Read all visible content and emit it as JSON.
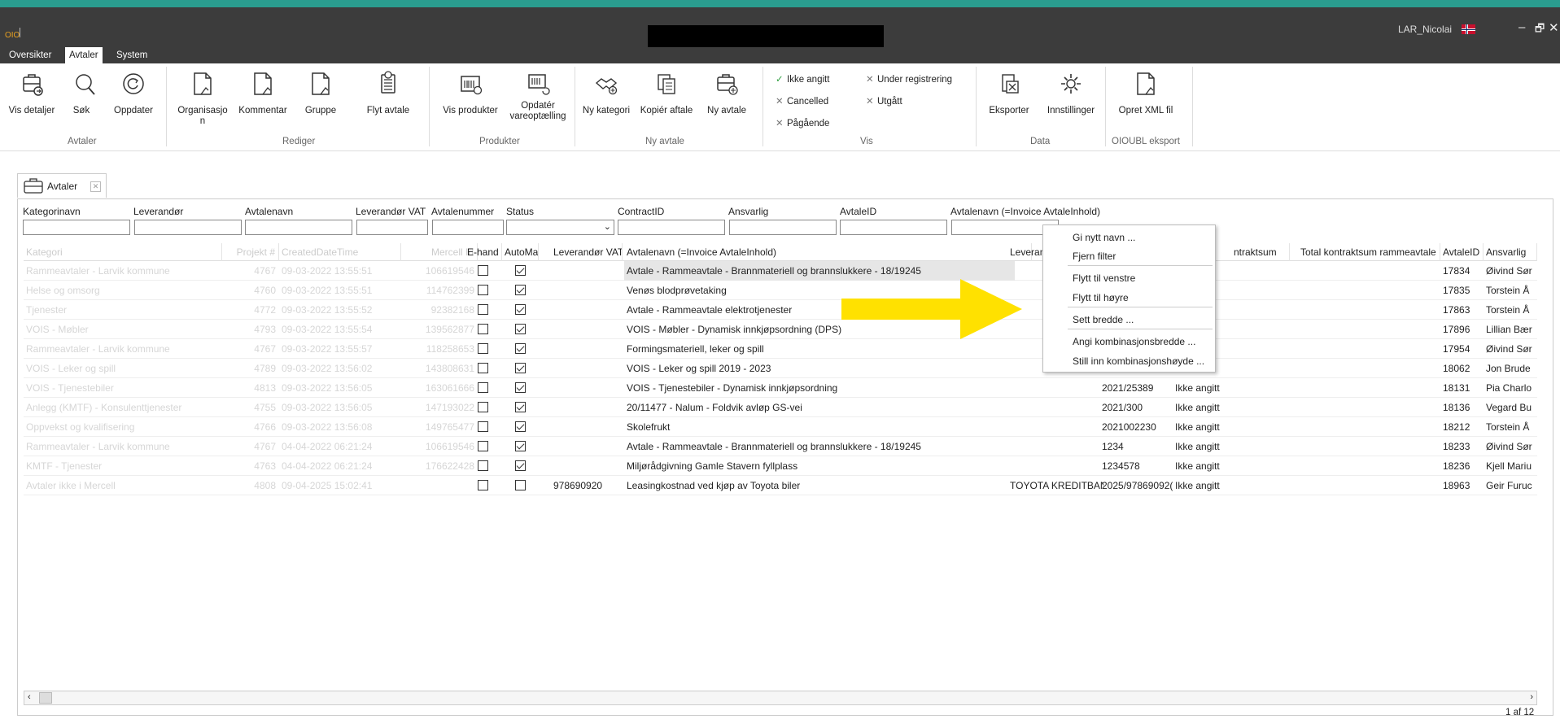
{
  "titlebar": {
    "app_logo": "OIO",
    "user": "LAR_Nicolai",
    "controls": {
      "minimize": "–",
      "restore": "🗗",
      "close": "✕"
    }
  },
  "menu_tabs": [
    "Oversikter",
    "Avtaler",
    "System"
  ],
  "ribbon": {
    "buttons": {
      "vis_detaljer": "Vis detaljer",
      "sok": "Søk",
      "oppdater": "Oppdater",
      "organisasjon_1": "Organisasjo",
      "organisasjon_2": "n",
      "kommentar": "Kommentar",
      "gruppe": "Gruppe",
      "flyt_avtale": "Flyt avtale",
      "vis_produkter": "Vis produkter",
      "opdater_1": "Opdatér",
      "opdater_2": "vareoptælling",
      "ny_kategori": "Ny kategori",
      "kopier_aftale": "Kopiér aftale",
      "ny_avtale": "Ny avtale",
      "eksporter": "Eksporter",
      "innstillinger": "Innstillinger",
      "opret_xml": "Opret XML fil"
    },
    "vis_filters": {
      "ikke_angitt": "Ikke angitt",
      "under_registrering": "Under registrering",
      "cancelled": "Cancelled",
      "utgatt": "Utgått",
      "pagaende": "Pågående"
    },
    "groups": {
      "avtaler": "Avtaler",
      "rediger": "Rediger",
      "produkter": "Produkter",
      "ny_avtale": "Ny avtale",
      "vis": "Vis",
      "data": "Data",
      "oioubl": "OIOUBL eksport"
    }
  },
  "doc_tab": {
    "label": "Avtaler"
  },
  "filters": {
    "kategorinavn": "Kategorinavn",
    "leverandor": "Leverandør",
    "avtalenavn": "Avtalenavn",
    "leverandor_vat": "Leverandør VAT",
    "avtalenummer": "Avtalenummer",
    "status": "Status",
    "contractid": "ContractID",
    "ansvarlig": "Ansvarlig",
    "avtaleid": "AvtaleID",
    "avtalenavn_invoice": "Avtalenavn (=Invoice AvtaleInhold)"
  },
  "grid": {
    "headers": {
      "kategori": "Kategori",
      "projekt": "Projekt #",
      "created": "CreatedDateTime",
      "mercell": "Mercell Id",
      "ehand": "E-hand",
      "automatch": "AutoMatcł",
      "levvat": "Leverandør VAT",
      "avtalenavn": "Avtalenavn (=Invoice AvtaleInhold)",
      "leveran": "Leveran",
      "kontraktsum": "ntraktsum",
      "total": "Total kontraktsum rammeavtale",
      "avtaleid": "AvtaleID",
      "ansvarlig": "Ansvarlig"
    },
    "rows": [
      {
        "kategori": "Rammeavtaler - Larvik kommune",
        "projekt": "4767",
        "created": "09-03-2022 13:55:51",
        "mercell": "106619546",
        "ehand": false,
        "auto": true,
        "levvat": "",
        "avtalenavn": "Avtale - Rammeavtale - Brannmateriell og brannslukkere - 18/19245",
        "leveran": "",
        "avtalenr": "",
        "status": "",
        "avtaleid": "17834",
        "ansvarlig": "Øivind Sør"
      },
      {
        "kategori": "Helse og omsorg",
        "projekt": "4760",
        "created": "09-03-2022 13:55:51",
        "mercell": "114762399",
        "ehand": false,
        "auto": true,
        "levvat": "",
        "avtalenavn": "Venøs blodprøvetaking",
        "leveran": "",
        "avtalenr": "",
        "status": "",
        "avtaleid": "17835",
        "ansvarlig": "Torstein Å"
      },
      {
        "kategori": "Tjenester",
        "projekt": "4772",
        "created": "09-03-2022 13:55:52",
        "mercell": "92382168",
        "ehand": false,
        "auto": true,
        "levvat": "",
        "avtalenavn": "Avtale - Rammeavtale elektrotjenester",
        "leveran": "",
        "avtalenr": "",
        "status": "",
        "avtaleid": "17863",
        "ansvarlig": "Torstein Å"
      },
      {
        "kategori": "VOIS - Møbler",
        "projekt": "4793",
        "created": "09-03-2022 13:55:54",
        "mercell": "139562877",
        "ehand": false,
        "auto": true,
        "levvat": "",
        "avtalenavn": "VOIS - Møbler - Dynamisk innkjøpsordning (DPS)",
        "leveran": "",
        "avtalenr": "",
        "status": "",
        "avtaleid": "17896",
        "ansvarlig": "Lillian Bær"
      },
      {
        "kategori": "Rammeavtaler - Larvik kommune",
        "projekt": "4767",
        "created": "09-03-2022 13:55:57",
        "mercell": "118258653",
        "ehand": false,
        "auto": true,
        "levvat": "",
        "avtalenavn": "Formingsmateriell, leker og spill",
        "leveran": "",
        "avtalenr": "",
        "status": "",
        "avtaleid": "17954",
        "ansvarlig": "Øivind Sør"
      },
      {
        "kategori": "VOIS - Leker og spill",
        "projekt": "4789",
        "created": "09-03-2022 13:56:02",
        "mercell": "143808631",
        "ehand": false,
        "auto": true,
        "levvat": "",
        "avtalenavn": "VOIS - Leker og spill 2019 - 2023",
        "leveran": "",
        "avtalenr": "",
        "status": "",
        "avtaleid": "18062",
        "ansvarlig": "Jon Brude"
      },
      {
        "kategori": "VOIS - Tjenestebiler",
        "projekt": "4813",
        "created": "09-03-2022 13:56:05",
        "mercell": "163061666",
        "ehand": false,
        "auto": true,
        "levvat": "",
        "avtalenavn": "VOIS - Tjenestebiler - Dynamisk innkjøpsordning",
        "leveran": "",
        "avtalenr": "2021/25389",
        "status": "Ikke angitt",
        "avtaleid": "18131",
        "ansvarlig": "Pia Charlo"
      },
      {
        "kategori": "Anlegg (KMTF) - Konsulenttjenester",
        "projekt": "4755",
        "created": "09-03-2022 13:56:05",
        "mercell": "147193022",
        "ehand": false,
        "auto": true,
        "levvat": "",
        "avtalenavn": "20/11477 - Nalum - Foldvik avløp GS-vei",
        "leveran": "",
        "avtalenr": "2021/300",
        "status": "Ikke angitt",
        "avtaleid": "18136",
        "ansvarlig": "Vegard Bu"
      },
      {
        "kategori": "Oppvekst og kvalifisering",
        "projekt": "4766",
        "created": "09-03-2022 13:56:08",
        "mercell": "149765477",
        "ehand": false,
        "auto": true,
        "levvat": "",
        "avtalenavn": "Skolefrukt",
        "leveran": "",
        "avtalenr": "2021002230",
        "status": "Ikke angitt",
        "avtaleid": "18212",
        "ansvarlig": "Torstein Å"
      },
      {
        "kategori": "Rammeavtaler - Larvik kommune",
        "projekt": "4767",
        "created": "04-04-2022 06:21:24",
        "mercell": "106619546",
        "ehand": false,
        "auto": true,
        "levvat": "",
        "avtalenavn": "Avtale - Rammeavtale - Brannmateriell og brannslukkere - 18/19245",
        "leveran": "",
        "avtalenr": "1234",
        "status": "Ikke angitt",
        "avtaleid": "18233",
        "ansvarlig": "Øivind Sør"
      },
      {
        "kategori": "KMTF - Tjenester",
        "projekt": "4763",
        "created": "04-04-2022 06:21:24",
        "mercell": "176622428",
        "ehand": false,
        "auto": true,
        "levvat": "",
        "avtalenavn": "Miljørådgivning Gamle Stavern fyllplass",
        "leveran": "",
        "avtalenr": "1234578",
        "status": "Ikke angitt",
        "avtaleid": "18236",
        "ansvarlig": "Kjell Mariu"
      },
      {
        "kategori": "Avtaler ikke i Mercell",
        "projekt": "4808",
        "created": "09-04-2025 15:02:41",
        "mercell": "",
        "ehand": false,
        "auto": false,
        "levvat": "978690920",
        "avtalenavn": "Leasingkostnad ved kjøp av Toyota biler",
        "leveran": "TOYOTA KREDITBAN",
        "avtalenr": "2025/97869092(",
        "status": "Ikke angitt",
        "avtaleid": "18963",
        "ansvarlig": "Geir Furuc"
      }
    ]
  },
  "context_menu": [
    "Gi nytt navn ...",
    "Fjern filter",
    "Flytt til venstre",
    "Flytt til høyre",
    "Sett bredde ...",
    "Angi kombinasjonsbredde ...",
    "Still inn kombinasjonshøyde ..."
  ],
  "pager": "1 af 12",
  "colors": {
    "titlebar": "#3c3c3c",
    "accent": "#2a9d8f",
    "annotation": "#ffe100"
  }
}
